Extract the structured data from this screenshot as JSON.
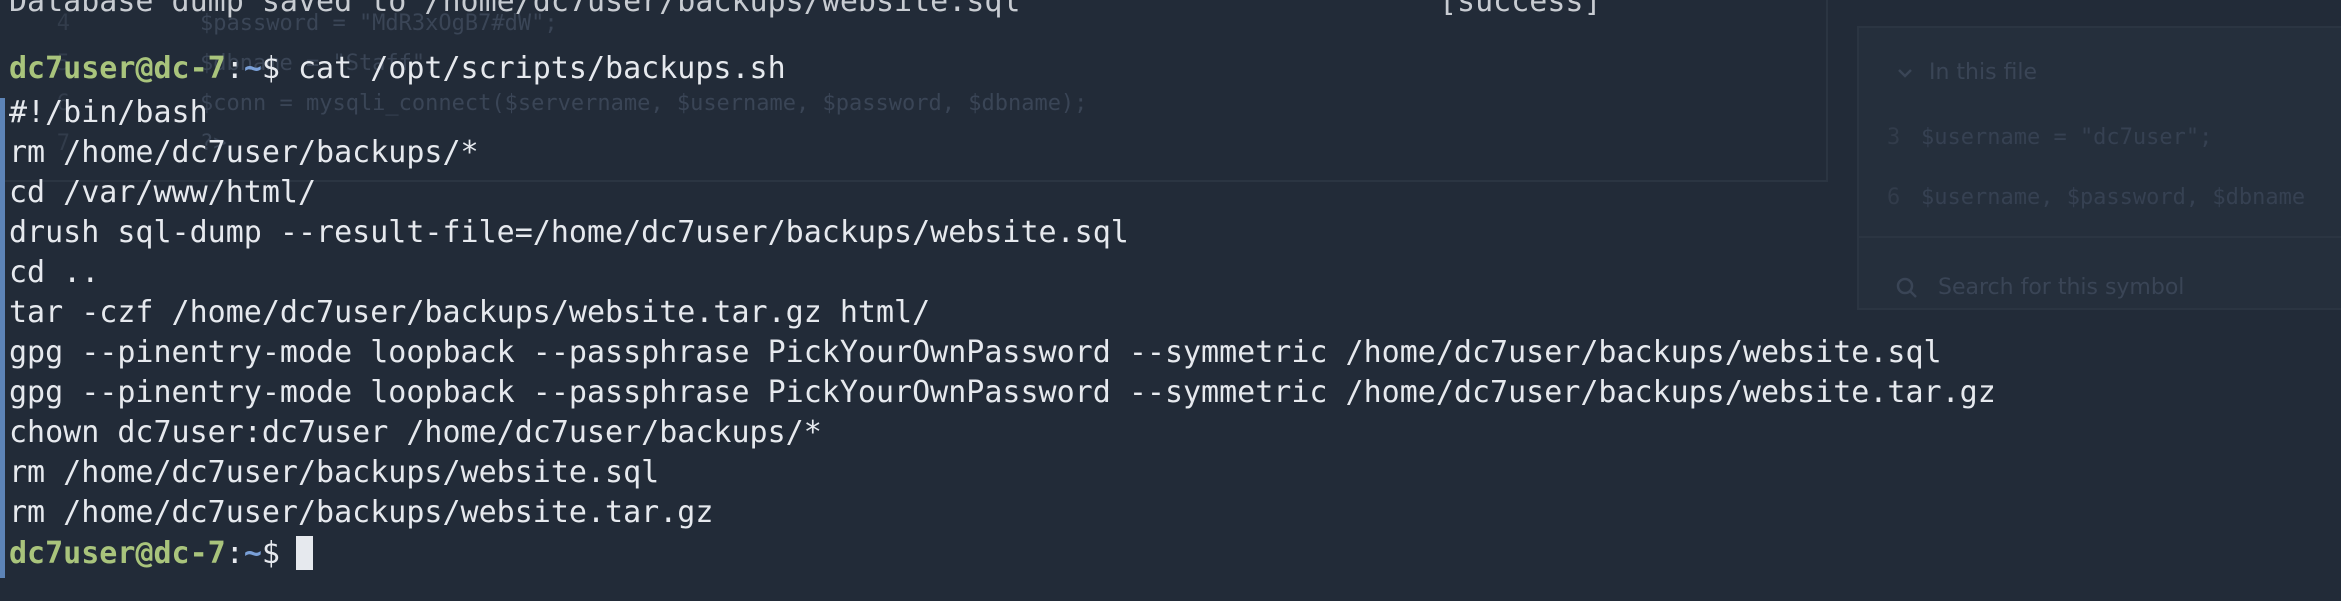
{
  "background_editor": {
    "code_lines": [
      {
        "number": "4",
        "code": "$password = \"MdR3xOgB7#dW\";"
      },
      {
        "number": "5",
        "code": "$dbname = \"Staff\";"
      },
      {
        "number": "6",
        "code": "$conn = mysqli_connect($servername, $username, $password, $dbname);"
      },
      {
        "number": "7",
        "code": "?>"
      }
    ]
  },
  "symbol_panel": {
    "header": "In this file",
    "references": [
      {
        "line": "3",
        "code": "$username = \"dc7user\";"
      },
      {
        "line": "6",
        "code": "$username, $password, $dbname"
      }
    ],
    "search_label": "Search for this symbol"
  },
  "terminal": {
    "previous_output": "Database dump saved to /home/dc7user/backups/website.sql",
    "previous_status": "[success]",
    "prompt_user": "dc7user@dc-7",
    "prompt_path": "~",
    "prompt_symbol": "$",
    "command": "cat /opt/scripts/backups.sh",
    "script_lines": [
      "#!/bin/bash",
      "rm /home/dc7user/backups/*",
      "cd /var/www/html/",
      "drush sql-dump --result-file=/home/dc7user/backups/website.sql",
      "cd ..",
      "tar -czf /home/dc7user/backups/website.tar.gz html/",
      "gpg --pinentry-mode loopback --passphrase PickYourOwnPassword --symmetric /home/dc7user/backups/website.sql",
      "gpg --pinentry-mode loopback --passphrase PickYourOwnPassword --symmetric /home/dc7user/backups/website.tar.gz",
      "chown dc7user:dc7user /home/dc7user/backups/*",
      "rm /home/dc7user/backups/website.sql",
      "rm /home/dc7user/backups/website.tar.gz"
    ]
  }
}
